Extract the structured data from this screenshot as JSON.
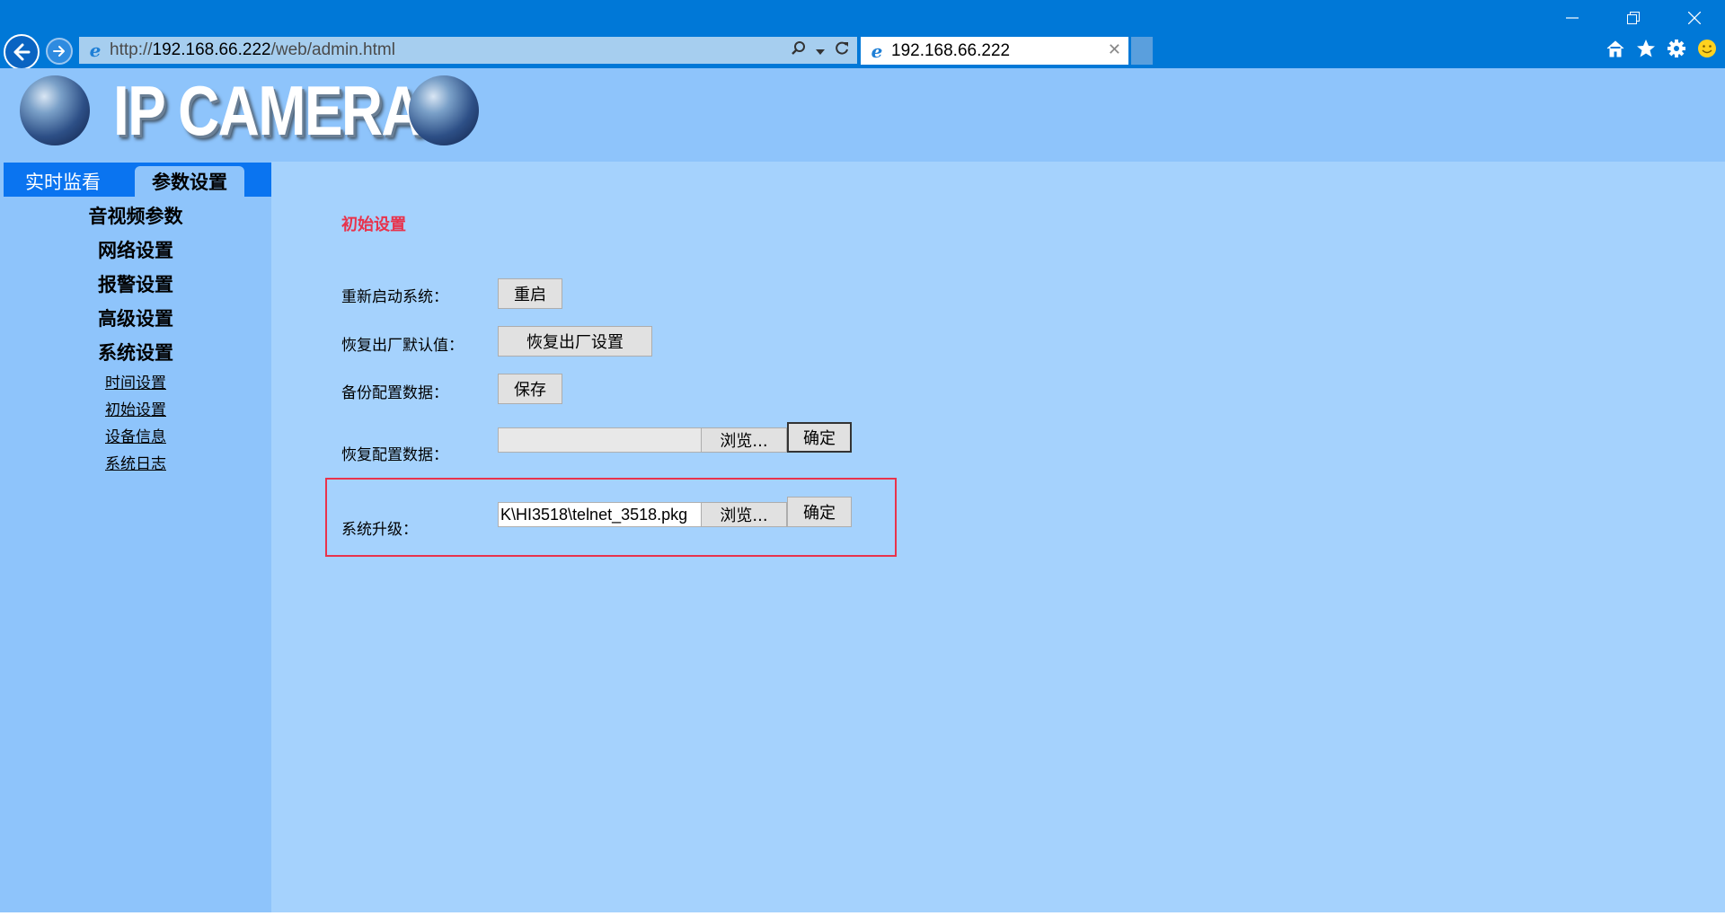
{
  "browser": {
    "url_prefix": "http://",
    "url_host": "192.168.66.222",
    "url_path": "/web/admin.html",
    "tab_title": "192.168.66.222",
    "icons": [
      "back-arrow-icon",
      "forward-arrow-icon",
      "ie-icon",
      "search-icon",
      "refresh-icon",
      "home-icon",
      "favorites-star-icon",
      "gear-icon",
      "smiley-icon"
    ]
  },
  "header": {
    "logo_text": "IP CAMERA"
  },
  "tabs": {
    "live": "实时监看",
    "settings": "参数设置"
  },
  "menu": {
    "items": [
      "音视频参数",
      "网络设置",
      "报警设置",
      "高级设置",
      "系统设置"
    ],
    "sub_items": [
      "时间设置",
      "初始设置",
      "设备信息",
      "系统日志"
    ]
  },
  "content": {
    "title": "初始设置",
    "reboot": {
      "label": "重新启动系统：",
      "button": "重启"
    },
    "factory": {
      "label": "恢复出厂默认值：",
      "button": "恢复出厂设置"
    },
    "backup": {
      "label": "备份配置数据：",
      "button": "保存"
    },
    "restore": {
      "label": "恢复配置数据：",
      "file_value": "",
      "browse": "浏览...",
      "confirm": "确定"
    },
    "upgrade": {
      "label": "系统升级：",
      "file_value": "K\\HI3518\\telnet_3518.pkg",
      "browse": "浏览...",
      "confirm": "确定"
    }
  },
  "colors": {
    "titlebar": "#0078d7",
    "page_bg": "#8ec4fb",
    "content_bg": "#a5d2fd",
    "tab_active_bar": "#0a74f0",
    "accent_red": "#e8334c"
  }
}
